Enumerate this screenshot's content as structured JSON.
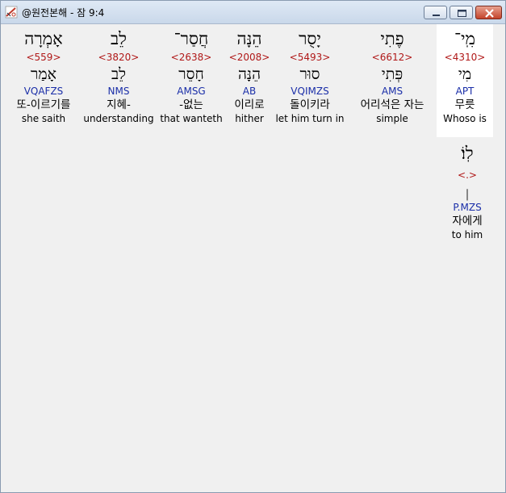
{
  "window": {
    "title": "@원전본해 - 잠 9:4"
  },
  "words": [
    {
      "hebrew": "מִֽי־",
      "strong": "<4310>",
      "lemma": "מִי",
      "morph": "APT",
      "korean": "무릇",
      "english": "Whoso is"
    },
    {
      "hebrew": "פֶתִי",
      "strong": "<6612>",
      "lemma": "פְּתִי",
      "morph": "AMS",
      "korean": "어리석은 자는",
      "english": "simple"
    },
    {
      "hebrew": "יָסֻר",
      "strong": "<5493>",
      "lemma": "סוּר",
      "morph": "VQIMZS",
      "korean": "돌이키라",
      "english": "let him turn in"
    },
    {
      "hebrew": "הֵנָּה",
      "strong": "<2008>",
      "lemma": "הֵנָּה",
      "morph": "AB",
      "korean": "이리로",
      "english": "hither"
    },
    {
      "hebrew": "חֲסַר־",
      "strong": "<2638>",
      "lemma": "חָסֵר",
      "morph": "AMSG",
      "korean": "-없는",
      "english": "that wanteth"
    },
    {
      "hebrew": "לֵב",
      "strong": "<3820>",
      "lemma": "לֵב",
      "morph": "NMS",
      "korean": "지혜-",
      "english": "understanding"
    },
    {
      "hebrew": "אָמְרָה",
      "strong": "<559>",
      "lemma": "אָמַר",
      "morph": "VQAFZS",
      "korean": "또-이르기를",
      "english": "she saith"
    },
    {
      "hebrew": "לֽוֹ׃",
      "strong": "<.>",
      "lemma": "׀",
      "morph": "P.MZS",
      "korean": "자에게",
      "english": "to him"
    }
  ]
}
